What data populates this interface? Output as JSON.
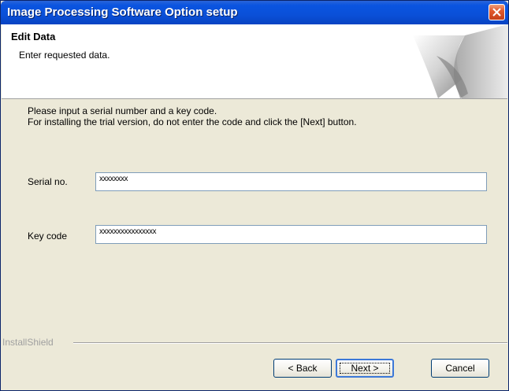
{
  "window": {
    "title": "Image Processing Software Option setup"
  },
  "header": {
    "title": "Edit Data",
    "subtitle": "Enter requested data."
  },
  "instructions": {
    "line1": "Please input a serial number and a key code.",
    "line2": "For installing the trial version, do not enter the code and click the [Next] button."
  },
  "form": {
    "serial_label": "Serial no.",
    "serial_value": "xxxxxxxx",
    "key_label": "Key code",
    "key_value": "xxxxxxxxxxxxxxxx"
  },
  "footer": {
    "group_label": "InstallShield"
  },
  "buttons": {
    "back": "< Back",
    "next": "Next >",
    "cancel": "Cancel"
  },
  "colors": {
    "titlebar": "#0a54e0",
    "dialog_bg": "#ece9d8",
    "close_button": "#e25a2d"
  }
}
